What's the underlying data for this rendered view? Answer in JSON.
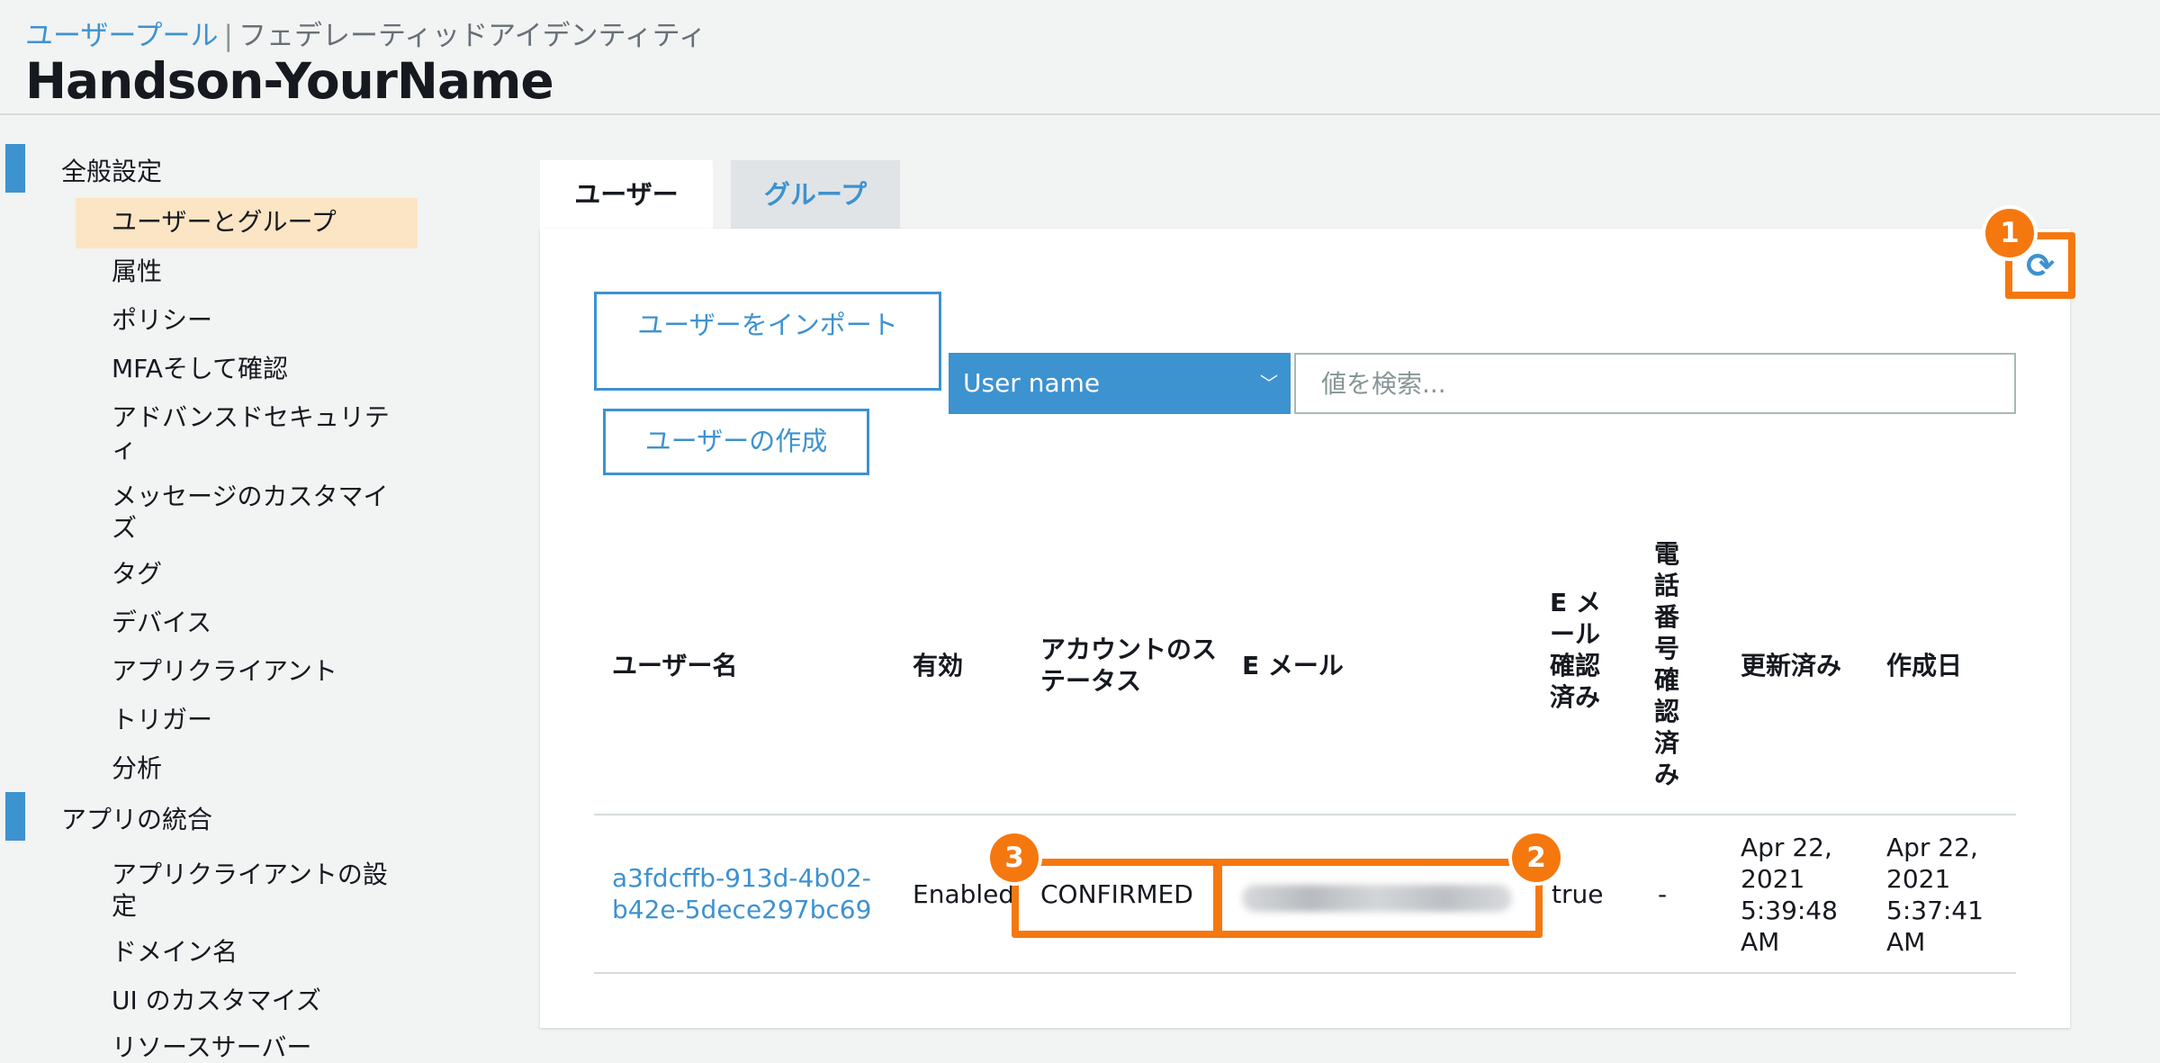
{
  "header": {
    "breadcrumb_link": "ユーザープール",
    "breadcrumb_sep": "|",
    "breadcrumb_current": "フェデレーティッドアイデンティティ",
    "title": "Handson-YourName"
  },
  "sidebar": {
    "section_general": "全般設定",
    "general_items": [
      "ユーザーとグループ",
      "属性",
      "ポリシー",
      "MFAそして確認",
      "アドバンスドセキュリティ",
      "メッセージのカスタマイズ",
      "タグ",
      "デバイス",
      "アプリクライアント",
      "トリガー",
      "分析"
    ],
    "section_app": "アプリの統合",
    "app_items": [
      "アプリクライアントの設定",
      "ドメイン名",
      "UI のカスタマイズ",
      "リソースサーバー"
    ]
  },
  "tabs": {
    "users": "ユーザー",
    "groups": "グループ"
  },
  "toolbar": {
    "import_label": "ユーザーをインポート",
    "create_label": "ユーザーの作成",
    "search_attr": "User name",
    "search_placeholder": "値を検索..."
  },
  "table": {
    "headers": {
      "username": "ユーザー名",
      "enabled": "有効",
      "status": "アカウントのステータス",
      "email": "E メール",
      "email_verified": "E メール確認済み",
      "phone_verified": "電話番号確認済み",
      "updated": "更新済み",
      "created": "作成日"
    },
    "rows": [
      {
        "username": "a3fdcffb-913d-4b02-b42e-5dece297bc69",
        "enabled": "Enabled",
        "status": "CONFIRMED",
        "email_verified": "true",
        "phone_verified": "-",
        "updated": "Apr 22, 2021 5:39:48 AM",
        "created": "Apr 22, 2021 5:37:41 AM"
      }
    ]
  },
  "annotations": {
    "badge1": "1",
    "badge2": "2",
    "badge3": "3"
  },
  "icons": {
    "refresh": "refresh-icon",
    "chevron": "chevron-down-icon"
  },
  "colors": {
    "accent": "#3d92d0",
    "highlight": "#f5780f",
    "selected": "#fbe5c4"
  }
}
